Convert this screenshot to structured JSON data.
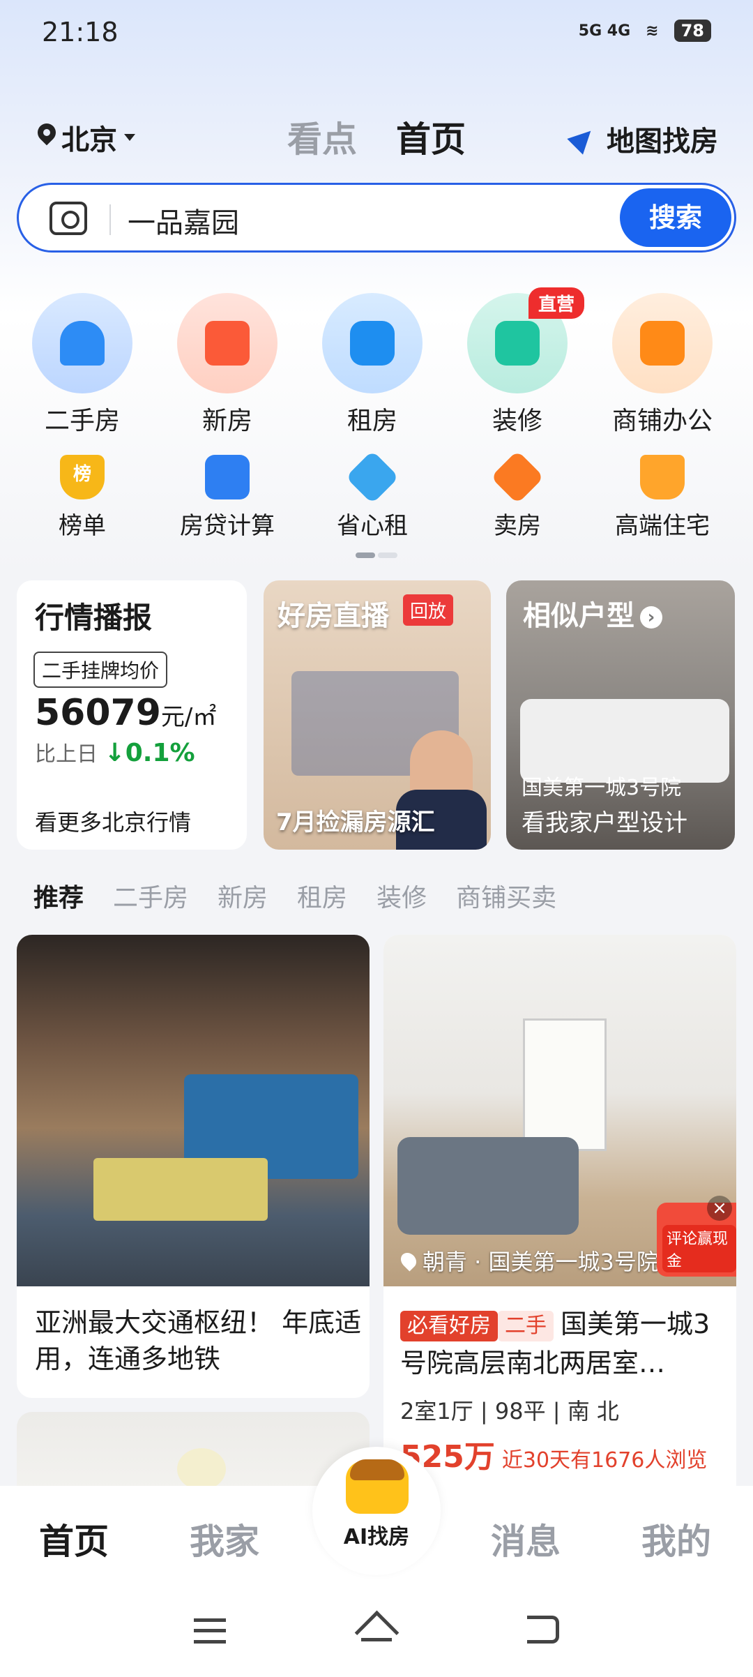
{
  "status": {
    "time": "21:18",
    "signal": "5G 4G",
    "battery": "78"
  },
  "header": {
    "city": "北京",
    "tabs": [
      {
        "label": "看点"
      },
      {
        "label": "首页"
      }
    ],
    "map_label": "地图找房"
  },
  "search": {
    "value": "一品嘉园",
    "button": "搜索"
  },
  "categories": [
    {
      "label": "二手房"
    },
    {
      "label": "新房"
    },
    {
      "label": "租房"
    },
    {
      "label": "装修",
      "badge": "直营"
    },
    {
      "label": "商铺办公"
    }
  ],
  "subcategories": [
    {
      "label": "榜单",
      "icon_text": "榜"
    },
    {
      "label": "房贷计算"
    },
    {
      "label": "省心租"
    },
    {
      "label": "卖房"
    },
    {
      "label": "高端住宅"
    }
  ],
  "cards": {
    "market": {
      "title": "行情播报",
      "tag": "二手挂牌均价",
      "price": "56079",
      "unit": "元/㎡",
      "compare": "比上日",
      "change": "0.1%",
      "more": "看更多北京行情"
    },
    "live": {
      "title": "好房直播",
      "badge": "回放",
      "caption": "7月捡漏房源汇"
    },
    "similar": {
      "title": "相似户型",
      "sub1": "国美第一城3号院",
      "sub2": "看我家户型设计"
    }
  },
  "feed_tabs": [
    {
      "label": "推荐"
    },
    {
      "label": "二手房"
    },
    {
      "label": "新房"
    },
    {
      "label": "租房"
    },
    {
      "label": "装修"
    },
    {
      "label": "商铺买卖"
    }
  ],
  "feed": {
    "left": {
      "caption": "亚洲最大交通枢纽！ 年底适用，连通多地铁"
    },
    "right": {
      "location": "朝青 · 国美第一城3号院",
      "promo": "评论赢现金",
      "badge1": "必看好房",
      "badge2": "二手",
      "title": "国美第一城3号院高层南北两居室…",
      "spec": "2室1厅 | 98平 | 南 北",
      "price": "525万",
      "views": "近30天有1676人浏览"
    }
  },
  "bottom_nav": {
    "home": "首页",
    "myhome": "我家",
    "ai": "AI找房",
    "messages": "消息",
    "me": "我的"
  },
  "colors": {
    "accent": "#1a64f0",
    "price_red": "#e2412c",
    "down_green": "#14a03c"
  }
}
